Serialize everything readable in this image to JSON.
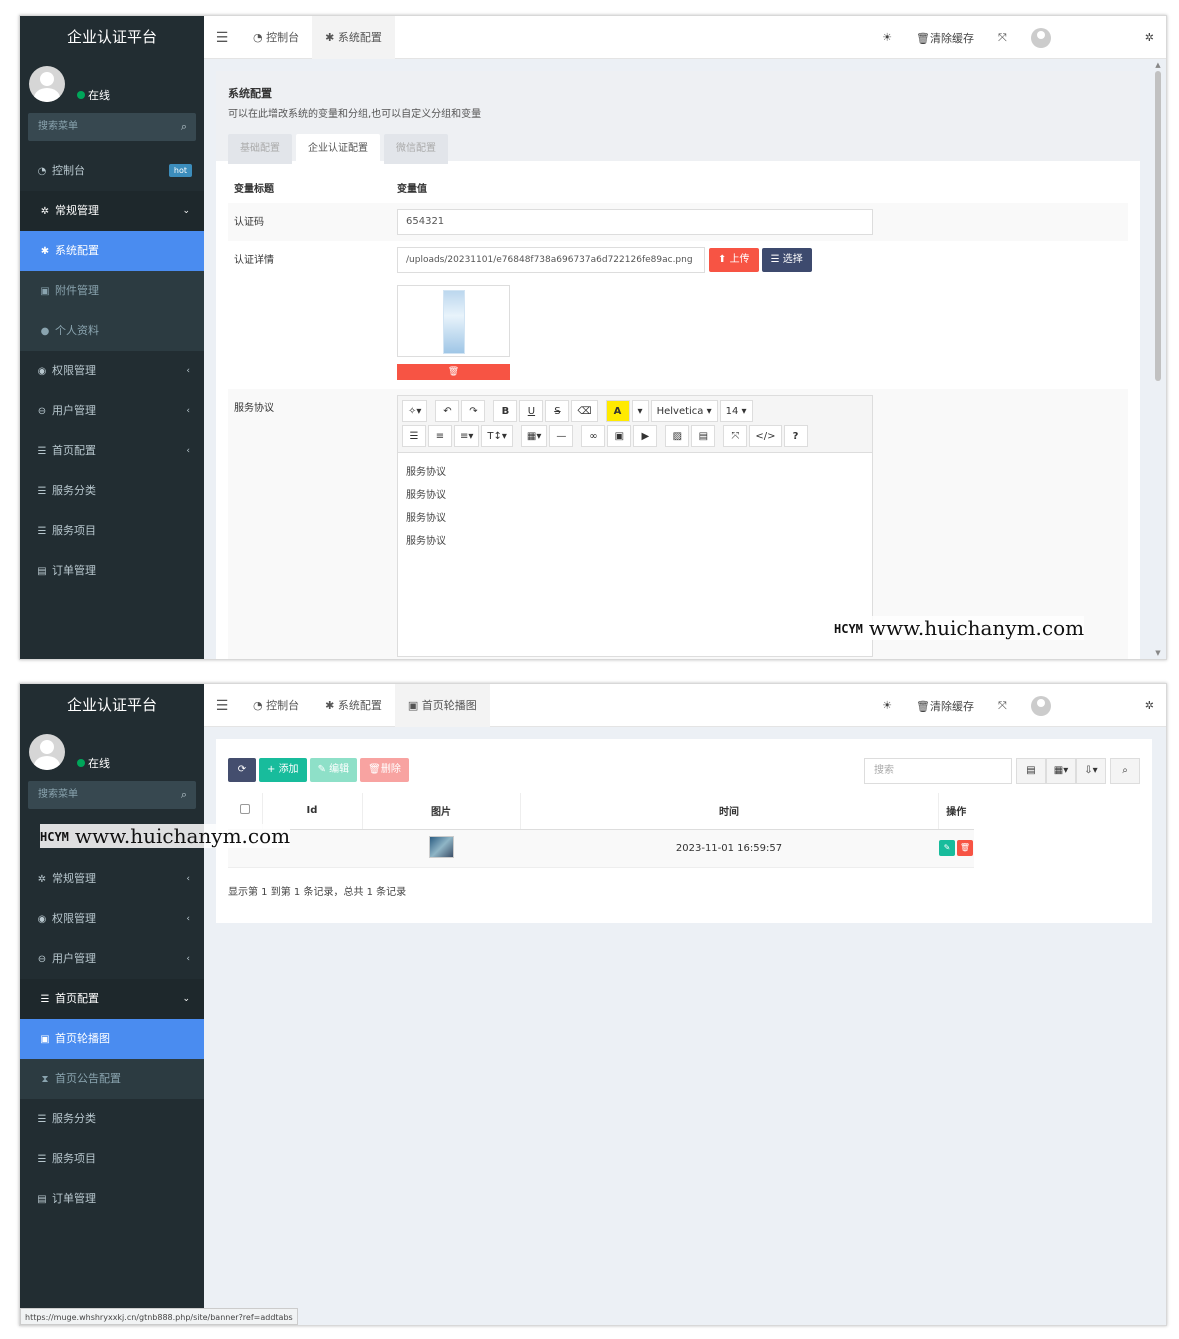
{
  "colors": {
    "sidebar": "#222d32",
    "accent": "#4a8cf0",
    "danger": "#f75444",
    "success": "#18bc9c"
  },
  "shot1": {
    "sidebar": {
      "brand": "企业认证平台",
      "status": "在线",
      "search_placeholder": "搜索菜单",
      "items": [
        {
          "label": "控制台",
          "icon": "dashboard-icon",
          "badge": "hot"
        },
        {
          "label": "常规管理",
          "icon": "cogs-icon"
        },
        {
          "label": "系统配置",
          "icon": "cog-icon"
        },
        {
          "label": "附件管理",
          "icon": "image-icon"
        },
        {
          "label": "个人资料",
          "icon": "user-icon"
        },
        {
          "label": "权限管理",
          "icon": "group-icon"
        },
        {
          "label": "用户管理",
          "icon": "user-circle-icon"
        },
        {
          "label": "首页配置",
          "icon": "list-icon"
        },
        {
          "label": "服务分类",
          "icon": "list-icon"
        },
        {
          "label": "服务项目",
          "icon": "list-icon"
        },
        {
          "label": "订单管理",
          "icon": "file-icon"
        }
      ]
    },
    "topbar": {
      "tabs": [
        "控制台",
        "系统配置"
      ],
      "clear_cache": "清除缓存"
    },
    "panel": {
      "title": "系统配置",
      "description": "可以在此增改系统的变量和分组,也可以自定义分组和变量",
      "tabs": [
        "基础配置",
        "企业认证配置",
        "微信配置"
      ],
      "col_title": "变量标题",
      "col_value": "变量值",
      "rows": {
        "code_label": "认证码",
        "code_value": "654321",
        "detail_label": "认证详情",
        "detail_value": "/uploads/20231101/e76848f738a696737a6d722126fe89ac.png",
        "upload": "上传",
        "choose": "选择",
        "agreement_label": "服务协议"
      },
      "editor": {
        "font": "Helvetica",
        "size": "14",
        "lines": [
          "服务协议",
          "服务协议",
          "服务协议",
          "服务协议"
        ]
      }
    },
    "watermark": {
      "logo": "HCYM",
      "text": "www.huichanym.com"
    }
  },
  "shot2": {
    "sidebar": {
      "brand": "企业认证平台",
      "status": "在线",
      "search_placeholder": "搜索菜单",
      "items": [
        {
          "label": "常规管理",
          "icon": "cogs-icon"
        },
        {
          "label": "权限管理",
          "icon": "group-icon"
        },
        {
          "label": "用户管理",
          "icon": "user-circle-icon"
        },
        {
          "label": "首页配置",
          "icon": "list-icon"
        },
        {
          "label": "首页轮播图",
          "icon": "image-icon"
        },
        {
          "label": "首页公告配置",
          "icon": "hourglass-icon"
        },
        {
          "label": "服务分类",
          "icon": "list-icon"
        },
        {
          "label": "服务项目",
          "icon": "list-icon"
        },
        {
          "label": "订单管理",
          "icon": "file-icon"
        }
      ]
    },
    "topbar": {
      "tabs": [
        "控制台",
        "系统配置",
        "首页轮播图"
      ],
      "clear_cache": "清除缓存"
    },
    "toolbar": {
      "add": "添加",
      "edit": "编辑",
      "delete": "删除",
      "search_placeholder": "搜索"
    },
    "table": {
      "headers": [
        "Id",
        "图片",
        "时间",
        "操作"
      ],
      "rows": [
        {
          "time": "2023-11-01 16:59:57"
        }
      ]
    },
    "pagination": "显示第 1 到第 1 条记录，总共 1 条记录",
    "status_url": "https://muge.whshryxxkj.cn/gtnb888.php/site/banner?ref=addtabs",
    "watermark": {
      "logo": "HCYM",
      "text": "www.huichanym.com"
    }
  }
}
